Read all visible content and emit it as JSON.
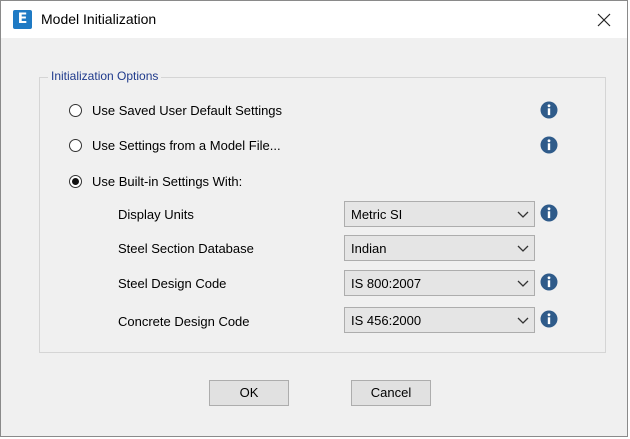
{
  "window": {
    "title": "Model Initialization",
    "icon_letter": "E",
    "close_glyph": "✕"
  },
  "group": {
    "label": "Initialization Options"
  },
  "options": [
    {
      "label": "Use Saved User Default Settings",
      "checked": false,
      "icon": "info-icon"
    },
    {
      "label": "Use Settings from a Model File...",
      "checked": false,
      "icon": "info-icon"
    },
    {
      "label": "Use Built-in Settings With:",
      "checked": true
    }
  ],
  "fields": [
    {
      "label": "Display Units",
      "value": "Metric SI",
      "icon": "info-icon"
    },
    {
      "label": "Steel Section Database",
      "value": "Indian"
    },
    {
      "label": "Steel Design Code",
      "value": "IS 800:2007",
      "icon": "info-icon"
    },
    {
      "label": "Concrete Design Code",
      "value": "IS 456:2000",
      "icon": "info-icon"
    }
  ],
  "buttons": {
    "ok": "OK",
    "cancel": "Cancel"
  },
  "colors": {
    "accent": "#1f7ac4",
    "group_label": "#1f3a8c",
    "info_icon": "#2f5b8a"
  }
}
